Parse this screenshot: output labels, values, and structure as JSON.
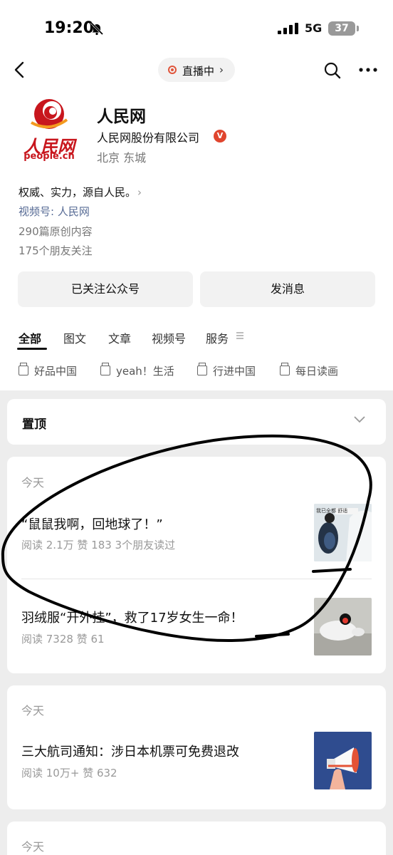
{
  "status_bar": {
    "time": "19:20",
    "network": "5G",
    "battery": "37"
  },
  "nav": {
    "live_label": "直播中",
    "live_chevron": "›"
  },
  "account": {
    "logo_text": "人民网",
    "logo_url": "people.cn",
    "name": "人民网",
    "organization": "人民网股份有限公司",
    "verified_mark": "V",
    "location": "北京 东城",
    "description": "权威、实力，源自人民。",
    "description_chevron": "›",
    "channel": "视频号: 人民网",
    "original_count": "290篇原创内容",
    "friends_follow": "175个朋友关注"
  },
  "actions": {
    "follow_label": "已关注公众号",
    "message_label": "发消息"
  },
  "tabs": [
    "全部",
    "图文",
    "文章",
    "视频号",
    "服务"
  ],
  "categories": [
    "好品中国",
    "yeah！生活",
    "行进中国",
    "每日读画"
  ],
  "pinned": {
    "label": "置顶"
  },
  "feed": [
    {
      "date": "今天",
      "articles": [
        {
          "title": "“鼠鼠我啊，回地球了！”",
          "meta": "阅读 2.1万  赞 183  3个朋友读过",
          "thumb_caption": "我已全都 舒适"
        },
        {
          "title": "羽绒服“开外挂”，救了17岁女生一命！",
          "meta": "阅读 7328  赞 61"
        }
      ]
    },
    {
      "date": "今天",
      "articles": [
        {
          "title": "三大航司通知：涉日本机票可免费退改",
          "meta": "阅读 10万+  赞 632"
        }
      ]
    },
    {
      "date": "今天",
      "articles": []
    }
  ],
  "colors": {
    "link": "#576b95",
    "brand_red": "#c8161d",
    "live_red": "#e0553b",
    "background": "#ededed"
  },
  "icons": [
    "bell-slash-icon",
    "signal-icon",
    "back-icon",
    "live-dot-icon",
    "search-icon",
    "more-icon",
    "verified-icon",
    "menu-lines-icon",
    "folder-icon",
    "chevron-down-icon"
  ]
}
